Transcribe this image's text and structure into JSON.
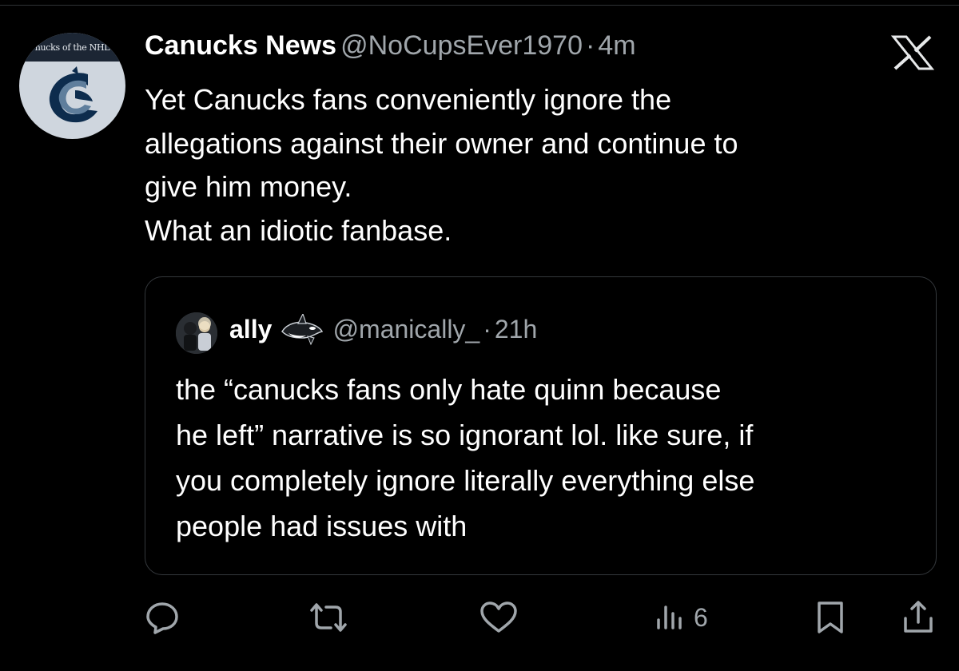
{
  "tweet": {
    "avatar_banner_text": "nucks of the NHL",
    "display_name": "Canucks News",
    "handle": "@NoCupsEver1970",
    "separator": "·",
    "time": "4m",
    "text": "Yet Canucks fans conveniently ignore the\nallegations against their owner and continue to\ngive him money.\nWhat an idiotic fanbase."
  },
  "quoted_tweet": {
    "display_name": "ally",
    "handle": "@manically_",
    "separator": "·",
    "time": "21h",
    "text": "the “canucks fans only hate quinn because\nhe left” narrative is so ignorant lol. like sure, if\nyou completely ignore literally everything else\npeople had issues with"
  },
  "actions": {
    "views_count": "6",
    "icons": [
      "reply-icon",
      "retweet-icon",
      "like-icon",
      "views-icon",
      "bookmark-icon",
      "share-icon"
    ]
  },
  "colors": {
    "background": "#000000",
    "text_primary": "#ffffff",
    "text_secondary": "#a0a6ab",
    "border": "#34383c"
  }
}
